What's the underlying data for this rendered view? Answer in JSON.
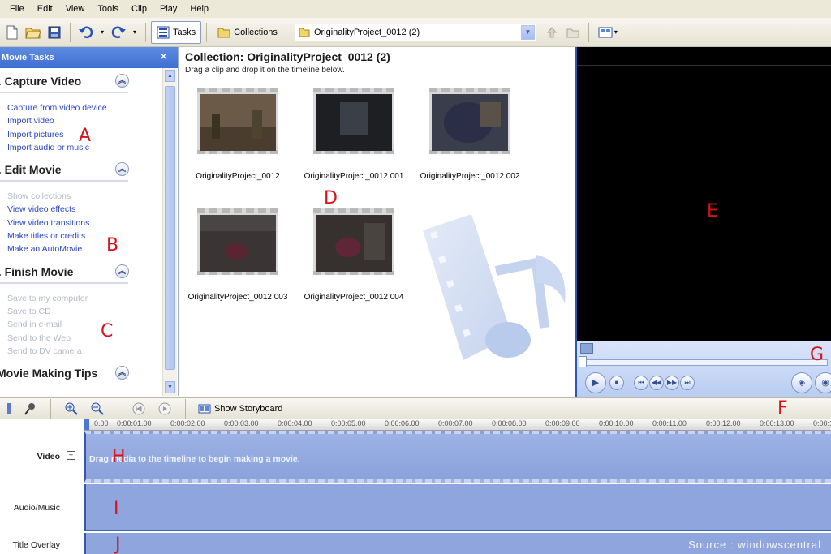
{
  "menu": [
    "File",
    "Edit",
    "View",
    "Tools",
    "Clip",
    "Play",
    "Help"
  ],
  "toolbar": {
    "tasks_label": "Tasks",
    "collections_label": "Collections",
    "project_value": "OriginalityProject_0012 (2)"
  },
  "tasks": {
    "header": "Movie Tasks",
    "capture": {
      "title": "1. Capture Video",
      "links": [
        "Capture from video device",
        "Import video",
        "Import pictures",
        "Import audio or music"
      ]
    },
    "edit": {
      "title": "2. Edit Movie",
      "links": [
        "Show collections",
        "View video effects",
        "View video transitions",
        "Make titles or credits",
        "Make an AutoMovie"
      ]
    },
    "finish": {
      "title": "3. Finish Movie",
      "links": [
        "Save to my computer",
        "Save to CD",
        "Send in e-mail",
        "Send to the Web",
        "Send to DV camera"
      ]
    },
    "tips": {
      "title": "Movie Making Tips"
    }
  },
  "collection": {
    "title": "Collection: OriginalityProject_0012 (2)",
    "subtitle": "Drag a clip and drop it on the timeline below.",
    "clips": [
      {
        "name": "OriginalityProject_0012",
        "tone": "#6b5a48"
      },
      {
        "name": "OriginalityProject_0012 001",
        "tone": "#1e1f22"
      },
      {
        "name": "OriginalityProject_0012 002",
        "tone": "#3a3d4c"
      },
      {
        "name": "OriginalityProject_0012 003",
        "tone": "#3a3434"
      },
      {
        "name": "OriginalityProject_0012 004",
        "tone": "#36302e"
      }
    ]
  },
  "timeline": {
    "show_storyboard_label": "Show Storyboard",
    "ruler": [
      "0.00",
      "0:00:01.00",
      "0:00:02.00",
      "0:00:03.00",
      "0:00:04.00",
      "0:00:05.00",
      "0:00:06.00",
      "0:00:07.00",
      "0:00:08.00",
      "0:00:09.00",
      "0:00:10.00",
      "0:00:11.00",
      "0:00:12.00",
      "0:00:13.00",
      "0:00:14.00"
    ],
    "tracks": {
      "video": "Video",
      "audio": "Audio/Music",
      "overlay": "Title Overlay"
    },
    "video_hint": "Drag media to the timeline to begin making a movie."
  },
  "annotations": {
    "A": "A",
    "B": "B",
    "C": "C",
    "D": "D",
    "E": "E",
    "F": "F",
    "G": "G",
    "H": "H",
    "I": "I",
    "J": "J"
  },
  "source": "Source : windowscentral",
  "colors": {
    "accent": "#3d6fd4",
    "annotation": "#d8121a",
    "timeline_track": "#8ea6dd"
  }
}
